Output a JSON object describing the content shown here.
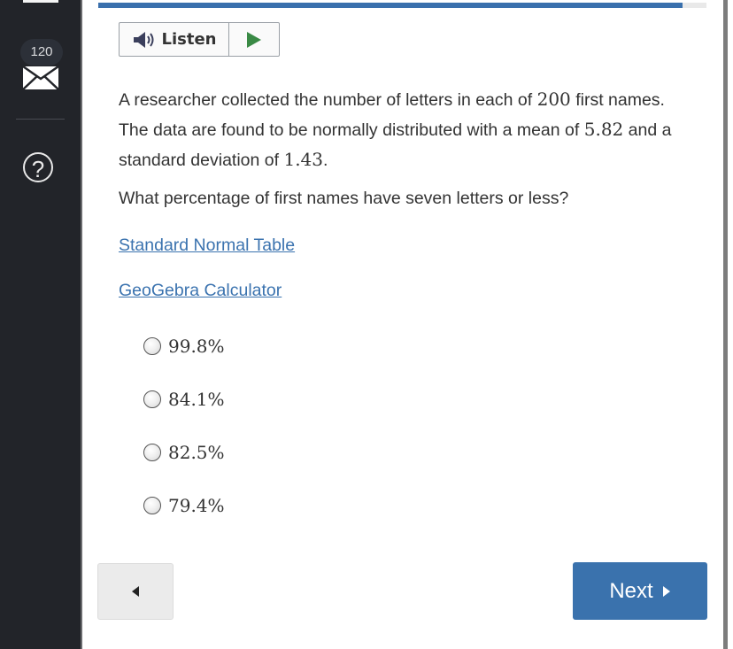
{
  "sidebar": {
    "mail_count": "120",
    "mail_icon": "envelope-icon",
    "help_icon": "question-circle-icon",
    "help_glyph": "?"
  },
  "progress": {
    "fraction": 0.96,
    "color": "#3a70ad"
  },
  "listen": {
    "label": "Listen",
    "speaker_icon": "speaker-icon",
    "play_icon": "play-icon"
  },
  "question": {
    "part1": "A researcher collected the number of letters in each of ",
    "n": "200",
    "part2": " first names. The data are found to be normally distributed with a mean of ",
    "mean": "5.82",
    "part3": " and a standard deviation of ",
    "sd": "1.43",
    "part4": ".",
    "prompt": "What percentage of first names have seven letters or less?"
  },
  "links": {
    "table": "Standard Normal Table",
    "calculator": "GeoGebra Calculator"
  },
  "choices": [
    {
      "label": "99.8%",
      "selected": false
    },
    {
      "label": "84.1%",
      "selected": false
    },
    {
      "label": "82.5%",
      "selected": false
    },
    {
      "label": "79.4%",
      "selected": false
    }
  ],
  "navigation": {
    "back_icon": "triangle-left-icon",
    "next_label": "Next",
    "next_icon": "triangle-right-icon",
    "next_color": "#3a72ad"
  }
}
